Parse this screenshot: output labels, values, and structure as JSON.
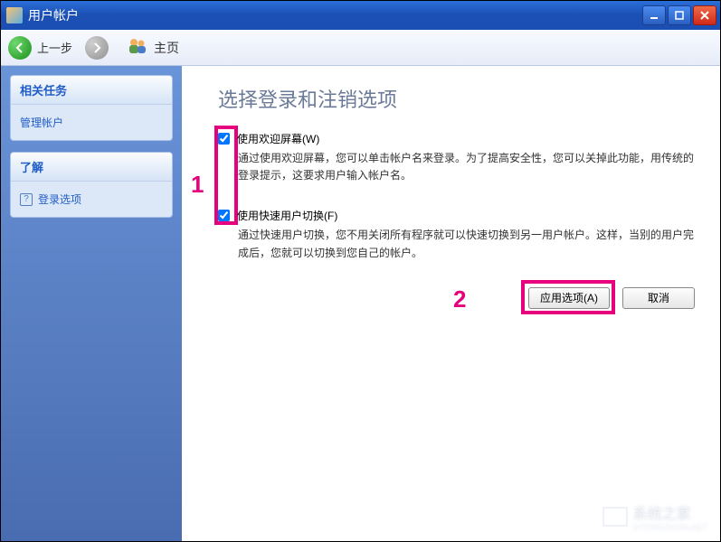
{
  "window": {
    "title": "用户帐户"
  },
  "toolbar": {
    "back_label": "上一步",
    "home_label": "主页"
  },
  "sidebar": {
    "panel1": {
      "header": "相关任务",
      "link1": "管理帐户"
    },
    "panel2": {
      "header": "了解",
      "link1": "登录选项"
    }
  },
  "main": {
    "title": "选择登录和注销选项",
    "option1": {
      "label": "使用欢迎屏幕(W)",
      "desc": "通过使用欢迎屏幕，您可以单击帐户名来登录。为了提高安全性，您可以关掉此功能，用传统的登录提示，这要求用户输入帐户名。",
      "checked": true
    },
    "option2": {
      "label": "使用快速用户切换(F)",
      "desc": "通过快速用户切换，您不用关闭所有程序就可以快速切换到另一用户帐户。这样，当别的用户完成后，您就可以切换到您自己的帐户。",
      "checked": true
    },
    "buttons": {
      "apply": "应用选项(A)",
      "cancel": "取消"
    }
  },
  "annotations": {
    "num1": "1",
    "num2": "2"
  },
  "watermark": {
    "text": "系统之家",
    "sub": "XITONGZHIJIA.NET"
  }
}
